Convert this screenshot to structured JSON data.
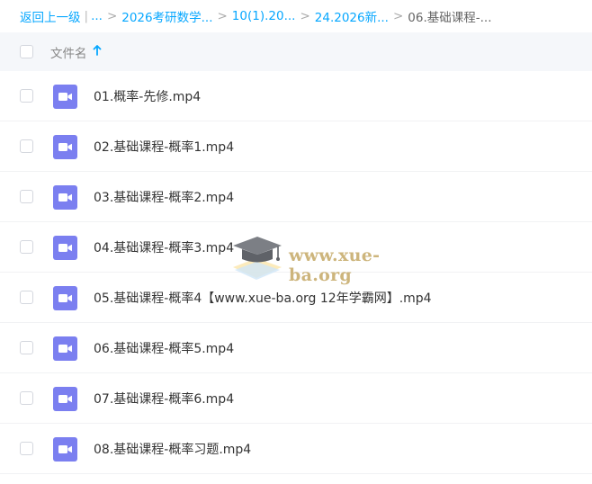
{
  "breadcrumb": {
    "back": "返回上一级",
    "sep_bar": "|",
    "ellipsis": "...",
    "sep": ">",
    "items": [
      "2026考研数学...",
      "10(1).20...",
      "24.2026新..."
    ],
    "current": "06.基础课程-..."
  },
  "header": {
    "filename_label": "文件名",
    "sort_icon": "sort-ascending-icon"
  },
  "files": [
    {
      "name": "01.概率-先修.mp4",
      "icon": "video-file-icon"
    },
    {
      "name": "02.基础课程-概率1.mp4",
      "icon": "video-file-icon"
    },
    {
      "name": "03.基础课程-概率2.mp4",
      "icon": "video-file-icon"
    },
    {
      "name": "04.基础课程-概率3.mp4",
      "icon": "video-file-icon"
    },
    {
      "name": "05.基础课程-概率4【www.xue-ba.org 12年学霸网】.mp4",
      "icon": "video-file-icon"
    },
    {
      "name": "06.基础课程-概率5.mp4",
      "icon": "video-file-icon"
    },
    {
      "name": "07.基础课程-概率6.mp4",
      "icon": "video-file-icon"
    },
    {
      "name": "08.基础课程-概率习题.mp4",
      "icon": "video-file-icon"
    }
  ],
  "watermark": {
    "text": "www.xue-ba.org"
  },
  "colors": {
    "link": "#06a7ff",
    "video_icon": "#7b7ff0",
    "header_bg": "#f5f7fa"
  }
}
